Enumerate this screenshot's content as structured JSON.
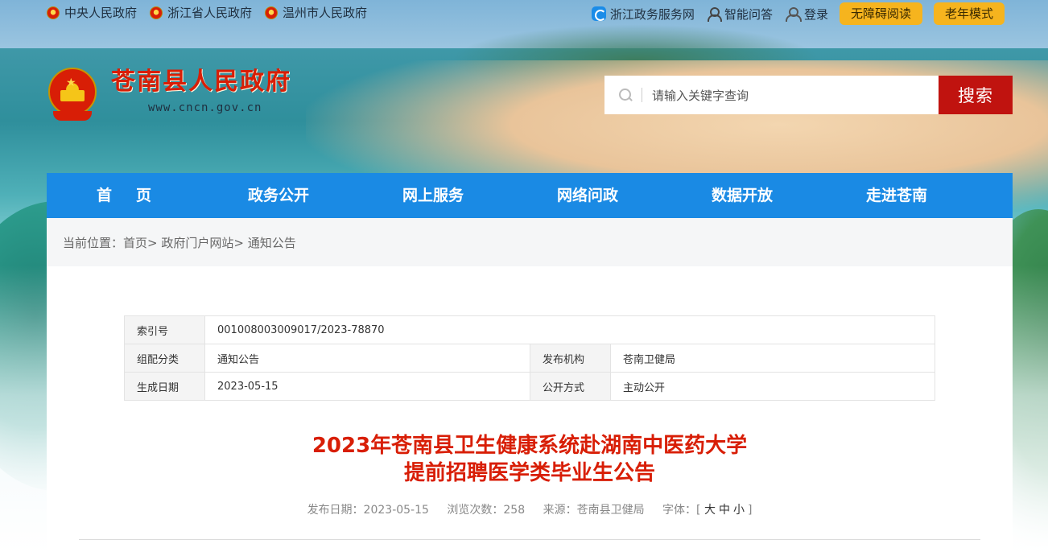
{
  "topbar": {
    "links_left": [
      "中央人民政府",
      "浙江省人民政府",
      "温州市人民政府"
    ],
    "zj_service": "浙江政务服务网",
    "smart_qa": "智能问答",
    "login": "登录",
    "accessible": "无障碍阅读",
    "elderly": "老年模式"
  },
  "brand": {
    "title": "苍南县人民政府",
    "url": "www.cncn.gov.cn"
  },
  "search": {
    "placeholder": "请输入关键字查询",
    "button": "搜索"
  },
  "nav": [
    "首页",
    "政务公开",
    "网上服务",
    "网络问政",
    "数据开放",
    "走进苍南"
  ],
  "breadcrumb": {
    "label": "当前位置：",
    "items": [
      "首页>",
      "政府门户网站>",
      "通知公告"
    ]
  },
  "meta": {
    "index_label": "索引号",
    "index_value": "001008003009017/2023-78870",
    "category_label": "组配分类",
    "category_value": "通知公告",
    "publisher_label": "发布机构",
    "publisher_value": "苍南卫健局",
    "date_label": "生成日期",
    "date_value": "2023-05-15",
    "mode_label": "公开方式",
    "mode_value": "主动公开"
  },
  "article": {
    "title_line1": "2023年苍南县卫生健康系统赴湖南中医药大学",
    "title_line2": "提前招聘医学类毕业生公告",
    "publish_date": "发布日期：2023-05-15",
    "views": "浏览次数：258",
    "source": "来源：苍南县卫健局",
    "font_label": "字体：[",
    "font_large": "大",
    "font_medium": "中",
    "font_small": "小",
    "font_end": "]"
  },
  "colors": {
    "nav_blue": "#1a8ae4",
    "brand_red": "#d81e06",
    "search_btn": "#c0130f",
    "pill_yellow": "#f6b41e"
  }
}
